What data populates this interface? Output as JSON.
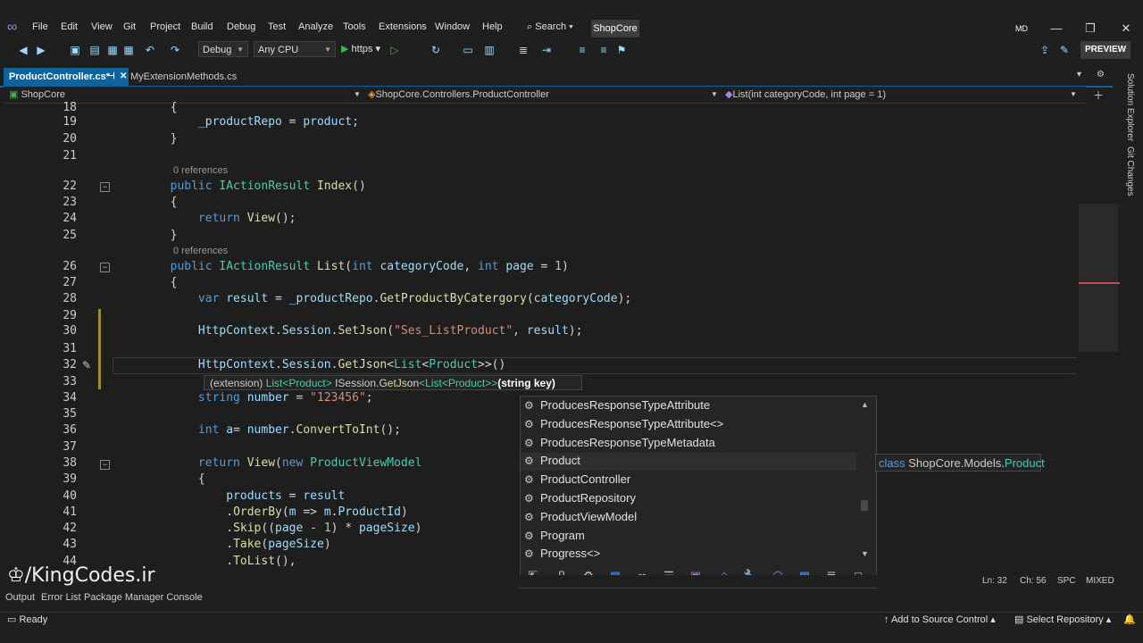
{
  "menu": [
    "File",
    "Edit",
    "View",
    "Git",
    "Project",
    "Build",
    "Debug",
    "Test",
    "Analyze",
    "Tools",
    "Extensions",
    "Window",
    "Help"
  ],
  "search_label": "Search",
  "solution_name": "ShopCore",
  "user_initials": "MD",
  "toolbar": {
    "config": "Debug",
    "platform": "Any CPU",
    "run_target": "https",
    "preview_label": "PREVIEW"
  },
  "tabs": {
    "active": "ProductController.cs*",
    "inactive": "MyExtensionMethods.cs"
  },
  "nav": {
    "project": "ShopCore",
    "class": "ShopCore.Controllers.ProductController",
    "member": "List(int categoryCode, int page = 1)"
  },
  "side_panels": [
    "Solution Explorer",
    "Git Changes"
  ],
  "code_lines": [
    {
      "n": "18",
      "tokens": [
        {
          "c": "pl",
          "t": "        {"
        }
      ]
    },
    {
      "n": "19",
      "tokens": [
        {
          "c": "pl",
          "t": "            "
        },
        {
          "c": "var",
          "t": "_productRepo"
        },
        {
          "c": "pl",
          "t": " = "
        },
        {
          "c": "var",
          "t": "product"
        },
        {
          "c": "pl",
          "t": ";"
        }
      ]
    },
    {
      "n": "20",
      "tokens": [
        {
          "c": "pl",
          "t": "        }"
        }
      ]
    },
    {
      "n": "21",
      "tokens": []
    },
    {
      "n": "22",
      "tokens": [
        {
          "c": "kw",
          "t": "        public "
        },
        {
          "c": "ty",
          "t": "IActionResult "
        },
        {
          "c": "fn",
          "t": "Index"
        },
        {
          "c": "pl",
          "t": "()"
        }
      ]
    },
    {
      "n": "23",
      "tokens": [
        {
          "c": "pl",
          "t": "        {"
        }
      ]
    },
    {
      "n": "24",
      "tokens": [
        {
          "c": "kw",
          "t": "            return "
        },
        {
          "c": "fn",
          "t": "View"
        },
        {
          "c": "pl",
          "t": "();"
        }
      ]
    },
    {
      "n": "25",
      "tokens": [
        {
          "c": "pl",
          "t": "        }"
        }
      ]
    },
    {
      "n": "26",
      "tokens": [
        {
          "c": "kw",
          "t": "        public "
        },
        {
          "c": "ty",
          "t": "IActionResult "
        },
        {
          "c": "fn",
          "t": "List"
        },
        {
          "c": "pl",
          "t": "("
        },
        {
          "c": "kw",
          "t": "int "
        },
        {
          "c": "var",
          "t": "categoryCode"
        },
        {
          "c": "pl",
          "t": ", "
        },
        {
          "c": "kw",
          "t": "int "
        },
        {
          "c": "var",
          "t": "page"
        },
        {
          "c": "pl",
          "t": " = "
        },
        {
          "c": "num",
          "t": "1"
        },
        {
          "c": "pl",
          "t": ")"
        }
      ]
    },
    {
      "n": "27",
      "tokens": [
        {
          "c": "pl",
          "t": "        {"
        }
      ]
    },
    {
      "n": "28",
      "tokens": [
        {
          "c": "kw",
          "t": "            var "
        },
        {
          "c": "var",
          "t": "result"
        },
        {
          "c": "pl",
          "t": " = "
        },
        {
          "c": "var",
          "t": "_productRepo"
        },
        {
          "c": "pl",
          "t": "."
        },
        {
          "c": "fn",
          "t": "GetProductByCatergory"
        },
        {
          "c": "pl",
          "t": "("
        },
        {
          "c": "var",
          "t": "categoryCode"
        },
        {
          "c": "pl",
          "t": ");"
        }
      ]
    },
    {
      "n": "29",
      "tokens": []
    },
    {
      "n": "30",
      "tokens": [
        {
          "c": "pl",
          "t": "            "
        },
        {
          "c": "var",
          "t": "HttpContext"
        },
        {
          "c": "pl",
          "t": "."
        },
        {
          "c": "var",
          "t": "Session"
        },
        {
          "c": "pl",
          "t": "."
        },
        {
          "c": "fn",
          "t": "SetJson"
        },
        {
          "c": "pl",
          "t": "("
        },
        {
          "c": "str",
          "t": "\"Ses_ListProduct\""
        },
        {
          "c": "pl",
          "t": ", "
        },
        {
          "c": "var",
          "t": "result"
        },
        {
          "c": "pl",
          "t": ");"
        }
      ]
    },
    {
      "n": "31",
      "tokens": []
    },
    {
      "n": "32",
      "tokens": [
        {
          "c": "pl",
          "t": "            "
        },
        {
          "c": "var",
          "t": "HttpContext"
        },
        {
          "c": "pl",
          "t": "."
        },
        {
          "c": "var",
          "t": "Session"
        },
        {
          "c": "pl",
          "t": "."
        },
        {
          "c": "fn",
          "t": "GetJson"
        },
        {
          "c": "pl",
          "t": "<"
        },
        {
          "c": "ty",
          "t": "List"
        },
        {
          "c": "pl",
          "t": "<"
        },
        {
          "c": "ty",
          "t": "Product"
        },
        {
          "c": "pl",
          "t": ">>()"
        }
      ]
    },
    {
      "n": "33",
      "tokens": []
    },
    {
      "n": "34",
      "tokens": [
        {
          "c": "kw",
          "t": "            string "
        },
        {
          "c": "var",
          "t": "number"
        },
        {
          "c": "pl",
          "t": " = "
        },
        {
          "c": "str",
          "t": "\"123456\""
        },
        {
          "c": "pl",
          "t": ";"
        }
      ]
    },
    {
      "n": "35",
      "tokens": []
    },
    {
      "n": "36",
      "tokens": [
        {
          "c": "kw",
          "t": "            int "
        },
        {
          "c": "var",
          "t": "a"
        },
        {
          "c": "pl",
          "t": "= "
        },
        {
          "c": "var",
          "t": "number"
        },
        {
          "c": "pl",
          "t": "."
        },
        {
          "c": "fn",
          "t": "ConvertToInt"
        },
        {
          "c": "pl",
          "t": "();"
        }
      ]
    },
    {
      "n": "37",
      "tokens": []
    },
    {
      "n": "38",
      "tokens": [
        {
          "c": "kw",
          "t": "            return "
        },
        {
          "c": "fn",
          "t": "View"
        },
        {
          "c": "pl",
          "t": "("
        },
        {
          "c": "kw",
          "t": "new "
        },
        {
          "c": "ty",
          "t": "ProductViewModel"
        }
      ]
    },
    {
      "n": "39",
      "tokens": [
        {
          "c": "pl",
          "t": "            {"
        }
      ]
    },
    {
      "n": "40",
      "tokens": [
        {
          "c": "pl",
          "t": "                "
        },
        {
          "c": "var",
          "t": "products"
        },
        {
          "c": "pl",
          "t": " = "
        },
        {
          "c": "var",
          "t": "result"
        }
      ]
    },
    {
      "n": "41",
      "tokens": [
        {
          "c": "pl",
          "t": "                ."
        },
        {
          "c": "fn",
          "t": "OrderBy"
        },
        {
          "c": "pl",
          "t": "("
        },
        {
          "c": "var",
          "t": "m"
        },
        {
          "c": "pl",
          "t": " => "
        },
        {
          "c": "var",
          "t": "m"
        },
        {
          "c": "pl",
          "t": "."
        },
        {
          "c": "var",
          "t": "ProductId"
        },
        {
          "c": "pl",
          "t": ")"
        }
      ]
    },
    {
      "n": "42",
      "tokens": [
        {
          "c": "pl",
          "t": "                ."
        },
        {
          "c": "fn",
          "t": "Skip"
        },
        {
          "c": "pl",
          "t": "(("
        },
        {
          "c": "var",
          "t": "page"
        },
        {
          "c": "pl",
          "t": " - "
        },
        {
          "c": "num",
          "t": "1"
        },
        {
          "c": "pl",
          "t": ") * "
        },
        {
          "c": "var",
          "t": "pageSize"
        },
        {
          "c": "pl",
          "t": ")"
        }
      ]
    },
    {
      "n": "43",
      "tokens": [
        {
          "c": "pl",
          "t": "                ."
        },
        {
          "c": "fn",
          "t": "Take"
        },
        {
          "c": "pl",
          "t": "("
        },
        {
          "c": "var",
          "t": "pageSize"
        },
        {
          "c": "pl",
          "t": ")"
        }
      ]
    },
    {
      "n": "44",
      "tokens": [
        {
          "c": "pl",
          "t": "                ."
        },
        {
          "c": "fn",
          "t": "ToList"
        },
        {
          "c": "pl",
          "t": "(),"
        }
      ]
    }
  ],
  "code_lens": [
    "0 references",
    "0 references"
  ],
  "signature_help": {
    "prefix": "(extension) ",
    "ret_type": "List<Product>",
    "iface": " ISession.",
    "method": "GetJson",
    "generic": "<List<Product>>",
    "param": "(string key)"
  },
  "completion_items": [
    "ProducesResponseTypeAttribute",
    "ProducesResponseTypeAttribute<>",
    "ProducesResponseTypeMetadata",
    "Product",
    "ProductController",
    "ProductRepository",
    "ProductViewModel",
    "Program",
    "Progress<>"
  ],
  "type_tooltip": {
    "kind": "class ",
    "ns": "ShopCore.Models.",
    "name": "Product"
  },
  "editor_status": {
    "line": "Ln: 32",
    "col": "Ch: 56",
    "ws": "SPC",
    "eol": "MIXED"
  },
  "bottom_tabs": [
    "Output",
    "Error List",
    "Package Manager Console"
  ],
  "status": {
    "ready": "Ready",
    "source_control": "Add to Source Control",
    "repo": "Select Repository"
  },
  "watermark": "/KingCodes.ir",
  "colors": {
    "accent": "#0e639c",
    "keyword": "#569cd6",
    "type": "#4ec9b0",
    "method": "#dcdcaa",
    "string": "#ce9178"
  }
}
